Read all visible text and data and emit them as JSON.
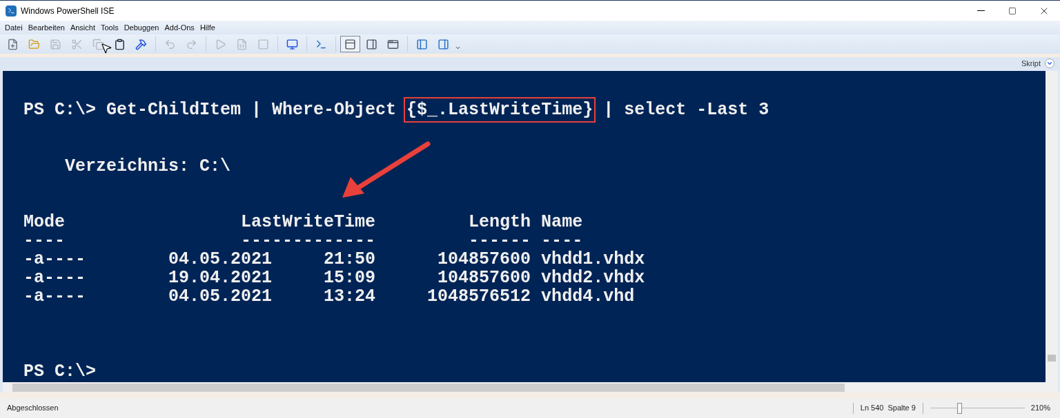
{
  "window": {
    "title": "Windows PowerShell ISE"
  },
  "menu": [
    "Datei",
    "Bearbeiten",
    "Ansicht",
    "Tools",
    "Debuggen",
    "Add-Ons",
    "Hilfe"
  ],
  "toolbar": [
    {
      "kind": "new",
      "disabled": false,
      "selected": false
    },
    {
      "kind": "open",
      "disabled": false,
      "selected": false
    },
    {
      "kind": "save",
      "disabled": true,
      "selected": false
    },
    {
      "kind": "cut",
      "disabled": true,
      "selected": false
    },
    {
      "kind": "copy",
      "disabled": true,
      "selected": false
    },
    {
      "kind": "paste",
      "disabled": false,
      "selected": false
    },
    {
      "kind": "clear",
      "disabled": false,
      "selected": false
    },
    {
      "kind": "sep"
    },
    {
      "kind": "undo",
      "disabled": true,
      "selected": false
    },
    {
      "kind": "redo",
      "disabled": true,
      "selected": false
    },
    {
      "kind": "sep"
    },
    {
      "kind": "run",
      "disabled": true,
      "selected": false
    },
    {
      "kind": "runsel",
      "disabled": true,
      "selected": false
    },
    {
      "kind": "stop",
      "disabled": true,
      "selected": false
    },
    {
      "kind": "sep"
    },
    {
      "kind": "remote",
      "disabled": false,
      "selected": false
    },
    {
      "kind": "sep"
    },
    {
      "kind": "shell",
      "disabled": false,
      "selected": false
    },
    {
      "kind": "sep"
    },
    {
      "kind": "layout-top",
      "disabled": false,
      "selected": true
    },
    {
      "kind": "layout-right",
      "disabled": false,
      "selected": false
    },
    {
      "kind": "layout-max",
      "disabled": false,
      "selected": false
    },
    {
      "kind": "sep"
    },
    {
      "kind": "addon-left",
      "disabled": false,
      "selected": false
    },
    {
      "kind": "addon-right",
      "disabled": false,
      "selected": false
    }
  ],
  "script_bar": {
    "label": "Skript"
  },
  "console": {
    "blocks": [
      {
        "kind": "command",
        "parts": [
          {
            "text": "PS C:\\> Get-ChildItem | Where-Object ",
            "highlighted": false
          },
          {
            "text": "{$_.LastWriteTime}",
            "highlighted": true
          },
          {
            "text": " | select -Last 3",
            "highlighted": false
          }
        ]
      },
      {
        "kind": "heading",
        "lines": [
          "    Verzeichnis: C:\\"
        ]
      },
      {
        "kind": "table",
        "lines": [
          "Mode                 LastWriteTime         Length Name",
          "----                 -------------         ------ ----",
          "-a----        04.05.2021     21:50      104857600 vhdd1.vhdx",
          "-a----        19.04.2021     15:09      104857600 vhdd2.vhdx",
          "-a----        04.05.2021     13:24     1048576512 vhdd4.vhd"
        ]
      },
      {
        "kind": "prompt",
        "lines": [
          "PS C:\\>"
        ]
      }
    ]
  },
  "status_bar": {
    "status": "Abgeschlossen",
    "line": "Ln 540",
    "column": "Spalte 9",
    "zoom": {
      "level": 0.3
    },
    "zoom_reading": "210%"
  }
}
